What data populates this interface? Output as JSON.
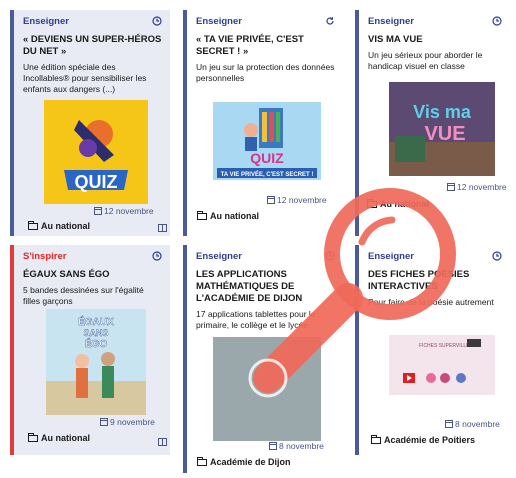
{
  "cards": [
    {
      "category": "Enseigner",
      "title": "« DEVIENS UN SUPER-HÉROS DU NET »",
      "description": "Une édition spéciale des Incollables® pour sensibiliser les enfants aux dangers (...)",
      "thumbnail_text": "QUIZ",
      "date": "12 novembre",
      "location": "Au national",
      "status_icon": "clock-icon"
    },
    {
      "category": "Enseigner",
      "title": "« TA VIE PRIVÉE, C'EST SECRET ! »",
      "description": "Un jeu sur la protection des données personnelles",
      "thumbnail_text": "QUIZ",
      "thumbnail_caption": "TA VIE PRIVÉE, C'EST SECRET !",
      "date": "12 novembre",
      "location": "Au national",
      "status_icon": "refresh-icon"
    },
    {
      "category": "Enseigner",
      "title": "VIS MA VUE",
      "description": "Un jeu sérieux pour aborder le handicap visuel en classe",
      "thumbnail_text_line1": "Vis ma",
      "thumbnail_text_line2": "VUE",
      "date": "12 novembre",
      "location": "Au national",
      "status_icon": "clock-icon"
    },
    {
      "category": "S'inspirer",
      "title": "ÉGAUX SANS ÉGO",
      "description": "5 bandes dessinées sur l'égalité filles garçons",
      "thumbnail_text_line1": "ÉGAUX",
      "thumbnail_text_line2": "SANS",
      "thumbnail_text_line3": "ÉGO",
      "date": "9 novembre",
      "location": "Au national",
      "status_icon": "clock-icon"
    },
    {
      "category": "Enseigner",
      "title": "LES APPLICATIONS MATHÉMATIQUES DE L'ACADÉMIE DE DIJON",
      "description": "17 applications tablettes pour le primaire, le collège et le lycée",
      "date": "8 novembre",
      "location": "Académie de Dijon",
      "status_icon": "clock-icon"
    },
    {
      "category": "Enseigner",
      "title": "DES FICHES POÈSIES INTERACTIVES",
      "description": "Pour faire de la poésie autrement",
      "thumbnail_text": "FICHES SUPERVILLE",
      "date": "8 novembre",
      "location": "Académie de Poitiers",
      "status_icon": "clock-icon"
    }
  ],
  "colors": {
    "accent": "#2f3f8f",
    "inspire": "#e32626",
    "magnifier": "#f06a5a"
  }
}
